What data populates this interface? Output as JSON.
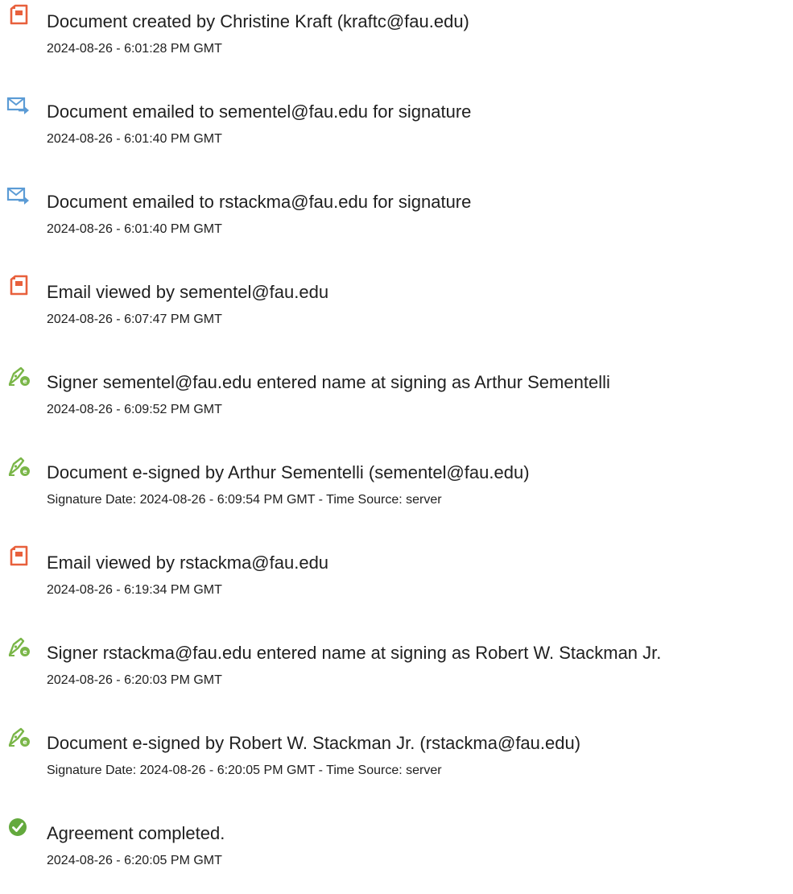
{
  "events": [
    {
      "icon": "document-icon",
      "title": "Document created by Christine Kraft (kraftc@fau.edu)",
      "timestamp": "2024-08-26 - 6:01:28 PM GMT"
    },
    {
      "icon": "email-icon",
      "title": "Document emailed to sementel@fau.edu for signature",
      "timestamp": "2024-08-26 - 6:01:40 PM GMT"
    },
    {
      "icon": "email-icon",
      "title": "Document emailed to rstackma@fau.edu for signature",
      "timestamp": "2024-08-26 - 6:01:40 PM GMT"
    },
    {
      "icon": "document-icon",
      "title": "Email viewed by sementel@fau.edu",
      "timestamp": "2024-08-26 - 6:07:47 PM GMT"
    },
    {
      "icon": "esign-pen-icon",
      "title": "Signer sementel@fau.edu entered name at signing as Arthur Sementelli",
      "timestamp": "2024-08-26 - 6:09:52 PM GMT"
    },
    {
      "icon": "esign-pen-icon",
      "title": "Document e-signed by Arthur Sementelli (sementel@fau.edu)",
      "timestamp": "Signature Date: 2024-08-26 - 6:09:54 PM GMT - Time Source: server"
    },
    {
      "icon": "document-icon",
      "title": "Email viewed by rstackma@fau.edu",
      "timestamp": "2024-08-26 - 6:19:34 PM GMT"
    },
    {
      "icon": "esign-pen-icon",
      "title": "Signer rstackma@fau.edu entered name at signing as Robert W. Stackman Jr.",
      "timestamp": "2024-08-26 - 6:20:03 PM GMT"
    },
    {
      "icon": "esign-pen-icon",
      "title": "Document e-signed by Robert W. Stackman Jr. (rstackma@fau.edu)",
      "timestamp": "Signature Date: 2024-08-26 - 6:20:05 PM GMT - Time Source: server"
    },
    {
      "icon": "check-circle-icon",
      "title": "Agreement completed.",
      "timestamp": "2024-08-26 - 6:20:05 PM GMT"
    }
  ],
  "colors": {
    "document_icon": "#e8603c",
    "email_icon": "#5b9bd5",
    "pen_icon": "#7ab648",
    "check_icon": "#63a93d"
  }
}
